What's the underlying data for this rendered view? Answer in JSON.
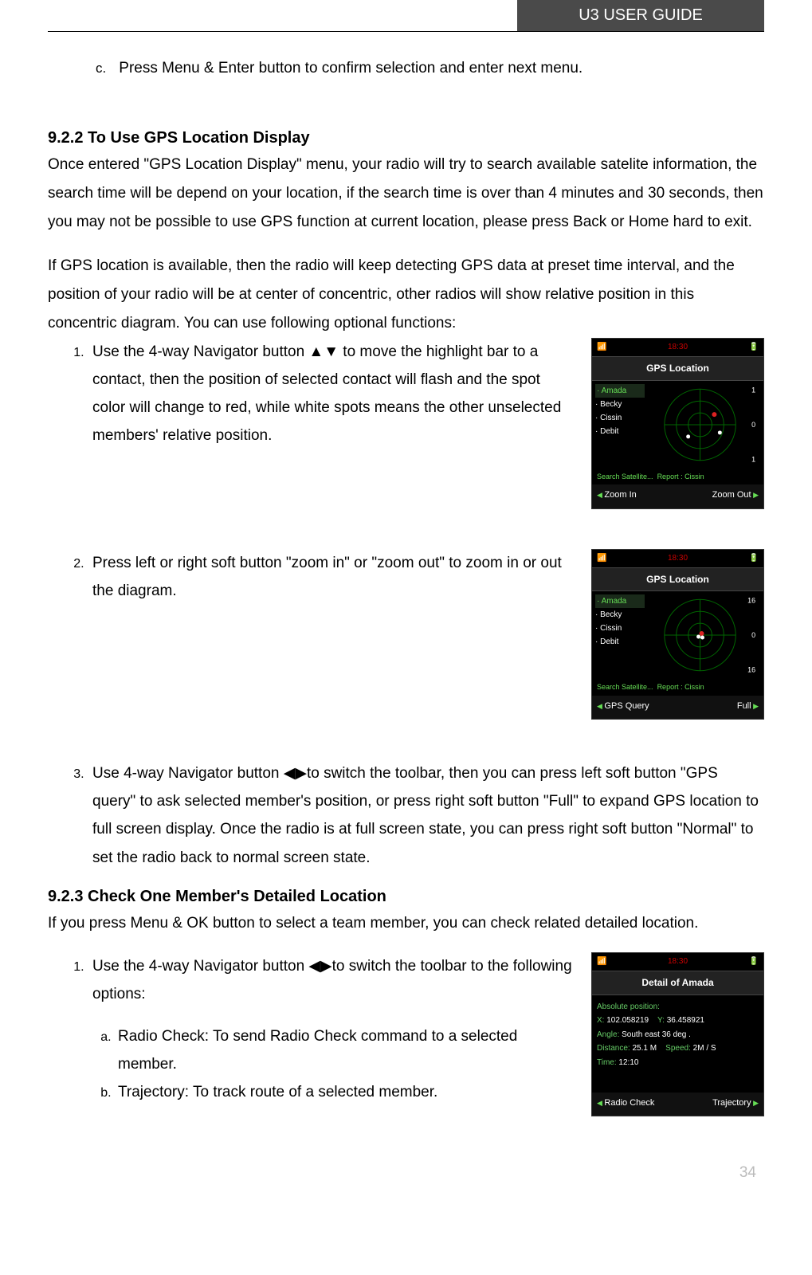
{
  "header": {
    "title": "U3 USER GUIDE"
  },
  "item_c": {
    "label": "c.",
    "text": "Press Menu & Enter button to confirm selection and enter next menu."
  },
  "sec922": {
    "heading": "9.2.2 To Use GPS Location Display",
    "p1": "Once entered \"GPS Location Display\" menu, your radio will try to search available satelite information, the search time will be depend on your location, if the search time is over than 4 minutes and 30 seconds, then you may not be possible to use GPS function at current location, please press Back or Home hard to exit.",
    "p2": "If GPS location is available, then the radio will keep detecting GPS data at preset time interval, and the position of your radio will be at center of concentric, other radios will show relative position in this concentric diagram. You can use following optional functions:",
    "li1": "Use the 4-way Navigator button ▲▼ to move the highlight bar to a contact, then the position of selected contact will flash and the spot color will change to red, while white spots means the other unselected members' relative position.",
    "li2": "Press left or right soft button \"zoom in\" or \"zoom out\" to zoom in or out the diagram.",
    "li3": "Use 4-way Navigator button ◀▶to switch the toolbar, then you can press left soft button \"GPS query\" to ask selected member's position, or press right soft button \"Full\" to expand GPS location to full screen display. Once the radio is at full screen state, you can press right soft button \"Normal\" to set the radio back to normal screen state."
  },
  "screen1": {
    "time": "18:30",
    "title": "GPS Location",
    "contacts": [
      "Amada",
      "Becky",
      "Cissin",
      "Debit"
    ],
    "selected": "Amada",
    "scale_top": "1",
    "scale_mid": "0",
    "scale_bot": "1",
    "status_left": "Search Satellite...",
    "status_right": "Report : Cissin",
    "soft_left": "Zoom In",
    "soft_right": "Zoom Out"
  },
  "screen2": {
    "time": "18:30",
    "title": "GPS Location",
    "contacts": [
      "Amada",
      "Becky",
      "Cissin",
      "Debit"
    ],
    "selected": "Amada",
    "scale_top": "16",
    "scale_mid": "0",
    "scale_bot": "16",
    "status_left": "Search Satellite...",
    "status_right": "Report : Cissin",
    "soft_left": "GPS Query",
    "soft_right": "Full"
  },
  "sec923": {
    "heading": "9.2.3 Check One Member's Detailed Location",
    "p1": "If you press Menu & OK button to select a team member, you can check related detailed location.",
    "li1_intro": "Use the 4-way Navigator button ◀▶to switch the toolbar to the following options:",
    "li1a_label": "a.",
    "li1a": "Radio Check: To send Radio Check command to a selected member.",
    "li1b_label": "b.",
    "li1b": "Trajectory: To track route of a selected member."
  },
  "screen3": {
    "time": "18:30",
    "title": "Detail of Amada",
    "abs_label": "Absolute position:",
    "x_label": "X:",
    "x_val": "102.058219",
    "y_label": "Y:",
    "y_val": "36.458921",
    "angle_label": "Angle:",
    "angle_val": "South east 36 deg .",
    "dist_label": "Distance:",
    "dist_val": "25.1 M",
    "speed_label": "Speed:",
    "speed_val": "2M / S",
    "time_label": "Time:",
    "time_val": "12:10",
    "soft_left": "Radio Check",
    "soft_right": "Trajectory"
  },
  "page_number": "34"
}
